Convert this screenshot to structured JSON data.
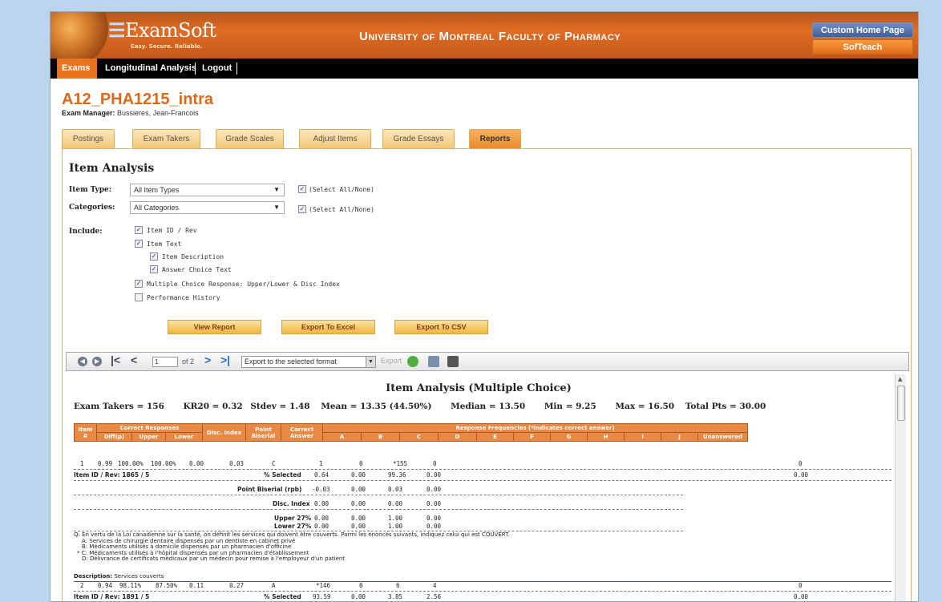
{
  "header": {
    "logo_e": "☰",
    "logo_text": "ExamSoft",
    "logo_tagline": "Easy. Secure. Reliable.",
    "institution": "University of Montreal Faculty of Pharmacy",
    "custom_home_label": "Custom Home Page",
    "softeach_label": "SofTeach",
    "brand_color": "#e06d24"
  },
  "nav": {
    "items": [
      "Exams",
      "Longitudinal Analysis",
      "Logout"
    ]
  },
  "exam": {
    "title": "A12_PHA1215_intra",
    "manager_label": "Exam Manager:",
    "manager_name": "Bussieres, Jean-Francois"
  },
  "tabs": [
    "Postings",
    "Exam Takers",
    "Grade Scales",
    "Adjust Items",
    "Grade Essays",
    "Reports"
  ],
  "item_analysis": {
    "title": "Item Analysis",
    "item_type_label": "Item Type:",
    "item_type_value": "All Item Types",
    "categories_label": "Categories:",
    "categories_value": "All Categories",
    "select_all_label": "(Select All/None)",
    "include_label": "Include:",
    "include_options": [
      "Item ID / Rev",
      "Item Text",
      "Item Description",
      "Answer Choice Text",
      "Multiple Choice Response: Upper/Lower & Disc Index",
      "Performance History"
    ],
    "buttons": [
      "View Report",
      "Export To Excel",
      "Export To CSV"
    ]
  },
  "toolbar": {
    "page": "1",
    "of_pages": "of 2",
    "export_format": "Export to the selected format",
    "export_label": "Export"
  },
  "report": {
    "title": "Item Analysis (Multiple Choice)",
    "stats": [
      "Exam Takers = 156",
      "KR20 = 0.32",
      "Stdev = 1.48",
      "Mean = 13.35 (44.50%)",
      "Median = 13.50",
      "Min = 9.25",
      "Max = 16.50",
      "Total Pts = 30.00"
    ],
    "headers": {
      "item": "Item #",
      "correct_responses": "Correct Responses",
      "diff": "Diff(p)",
      "upper": "Upper",
      "lower": "Lower",
      "disc_index": "Disc. Index",
      "point_biserial": "Point Biserial",
      "correct_answer": "Correct Answer",
      "response_freq": "Response Frequencies (*Indicates correct answer)",
      "choices": [
        "A",
        "B",
        "C",
        "D",
        "E",
        "F",
        "G",
        "H",
        "I",
        "J"
      ],
      "unanswered": "Unanswered"
    },
    "item1": {
      "num": "1",
      "diff": "0.99",
      "upper": "100.00%",
      "lower": "100.00%",
      "disc": "0.00",
      "pb": "0.03",
      "answer": "C",
      "freq": [
        "1",
        "0",
        "*155",
        "0"
      ],
      "unanswered": "0",
      "id_label": "Item ID / Rev: 1865 / 5",
      "pct_label": "% Selected",
      "pct": [
        "0.64",
        "0.00",
        "99.36",
        "0.00"
      ],
      "pct_unanswered": "0.00",
      "rpb_label": "Point Biserial (rpb)",
      "rpb": [
        "-0.03",
        "0.00",
        "0.03",
        "0.00"
      ],
      "disc_label": "Disc. Index",
      "disc_vals": [
        "0.00",
        "0.00",
        "0.00",
        "0.00"
      ],
      "upper_label": "Upper 27%",
      "upper_vals": [
        "0.00",
        "0.00",
        "1.00",
        "0.00"
      ],
      "lower_label": "Lower 27%",
      "lower_vals": [
        "0.00",
        "0.00",
        "1.00",
        "0.00"
      ],
      "question": "Q: En vertu de la Loi canadienne sur la santé, on définit les services qui doivent être couverts. Parmi les énoncés suivants, indiquez celui qui est COUVERT.",
      "choices_text": [
        "A: Services de chirurgie dentaire dispensés par un dentiste en cabinet privé",
        "B: Médicaments utilisés à domicile dispensés par un pharmacien d'officine",
        "* C: Médicaments utilisés à l'hôpital dispensés par un pharmacien d'établissement",
        "D: Délivrance de certificats médicaux par un médecin pour remise à l'employeur d'un patient"
      ],
      "description_label": "Description:",
      "description": "Services couverts"
    },
    "item2": {
      "num": "2",
      "diff": "0.94",
      "upper": "98.11%",
      "lower": "87.50%",
      "disc": "0.11",
      "pb": "0.27",
      "answer": "A",
      "freq": [
        "*146",
        "0",
        "6",
        "4"
      ],
      "unanswered": "0",
      "id_label": "Item ID / Rev: 1891 / 5",
      "pct_label": "% Selected",
      "pct": [
        "93.59",
        "0.00",
        "3.85",
        "2.56"
      ],
      "pct_unanswered": "0.00"
    }
  }
}
